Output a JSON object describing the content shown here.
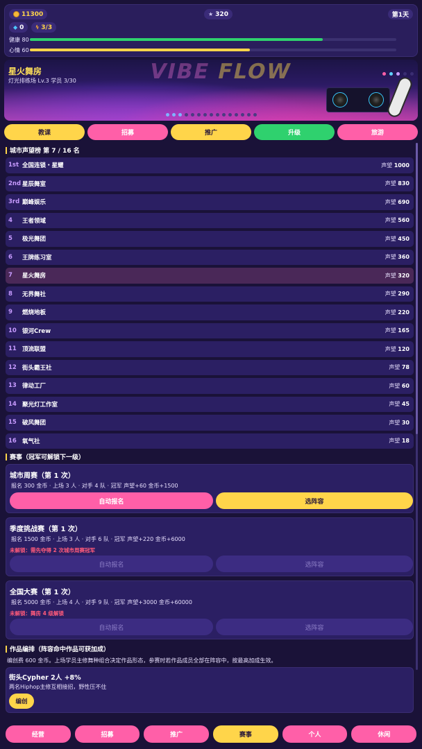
{
  "status": {
    "coins": "11300",
    "stars": "320",
    "day": "第1天",
    "gems": "0",
    "energy": "3/3",
    "health_label": "健康 80",
    "health_value": 80,
    "mood_label": "心情 60",
    "mood_value": 60,
    "colors": {
      "health": "#2fd16e",
      "mood": "#ffd54a",
      "track": "#3b3170"
    }
  },
  "banner": {
    "title": "星火舞房",
    "subtitle": "灯光排练场 Lv.3  学员 3/30"
  },
  "actions": [
    "教课",
    "招募",
    "推广",
    "升级",
    "旅游"
  ],
  "ranking": {
    "title": "城市声望榜  第 7 / 16 名",
    "rep_label": "声望",
    "rows": [
      {
        "pos": "1st",
        "name": "全国连锁・星耀",
        "rep": "1000"
      },
      {
        "pos": "2nd",
        "name": "星辰舞室",
        "rep": "830"
      },
      {
        "pos": "3rd",
        "name": "巅峰娱乐",
        "rep": "690"
      },
      {
        "pos": "4",
        "name": "王者领域",
        "rep": "560"
      },
      {
        "pos": "5",
        "name": "极光舞团",
        "rep": "450"
      },
      {
        "pos": "6",
        "name": "王牌练习室",
        "rep": "360"
      },
      {
        "pos": "7",
        "name": "星火舞房",
        "rep": "320",
        "me": true
      },
      {
        "pos": "8",
        "name": "无界舞社",
        "rep": "290"
      },
      {
        "pos": "9",
        "name": "燃烧地板",
        "rep": "220"
      },
      {
        "pos": "10",
        "name": "银河Crew",
        "rep": "165"
      },
      {
        "pos": "11",
        "name": "顶流联盟",
        "rep": "120"
      },
      {
        "pos": "12",
        "name": "街头霸王社",
        "rep": "78"
      },
      {
        "pos": "13",
        "name": "律动工厂",
        "rep": "60"
      },
      {
        "pos": "14",
        "name": "聚光灯工作室",
        "rep": "45"
      },
      {
        "pos": "15",
        "name": "破风舞团",
        "rep": "30"
      },
      {
        "pos": "16",
        "name": "氧气社",
        "rep": "18"
      }
    ]
  },
  "events": {
    "title": "赛事（冠军可解锁下一级）",
    "items": [
      {
        "name": "城市周赛（第 1 次）",
        "desc": "报名 300 金币 · 上场 3 人 · 对手 4 队 · 冠军 声望+60 金币+1500",
        "lock": "",
        "auto": "自动报名",
        "lineup": "选阵容",
        "enabled": true
      },
      {
        "name": "季度挑战赛（第 1 次）",
        "desc": "报名 1500 金币 · 上场 3 人 · 对手 6 队 · 冠军 声望+220 金币+6000",
        "lock": "未解锁：需先夺得 2 次城市周赛冠军",
        "auto": "自动报名",
        "lineup": "选阵容",
        "enabled": false
      },
      {
        "name": "全国大赛（第 1 次）",
        "desc": "报名 5000 金币 · 上场 4 人 · 对手 9 队 · 冠军 声望+3000 金币+60000",
        "lock": "未解锁：舞房 4 级解锁",
        "auto": "自动报名",
        "lineup": "选阵容",
        "enabled": false
      }
    ]
  },
  "works": {
    "title": "作品编排（阵容命中作品可获加成）",
    "desc": "编创费 600 金币。上场学员主修舞种组合决定作品形态，参赛时若作品成员全部在阵容中，按最高加成生效。",
    "card": {
      "title": "街头Cypher  2人  +8%",
      "desc": "两名Hiphop主修互相接招，野性压不住",
      "button": "编创"
    }
  },
  "nav": [
    "经营",
    "招募",
    "推广",
    "赛事",
    "个人",
    "休闲"
  ]
}
